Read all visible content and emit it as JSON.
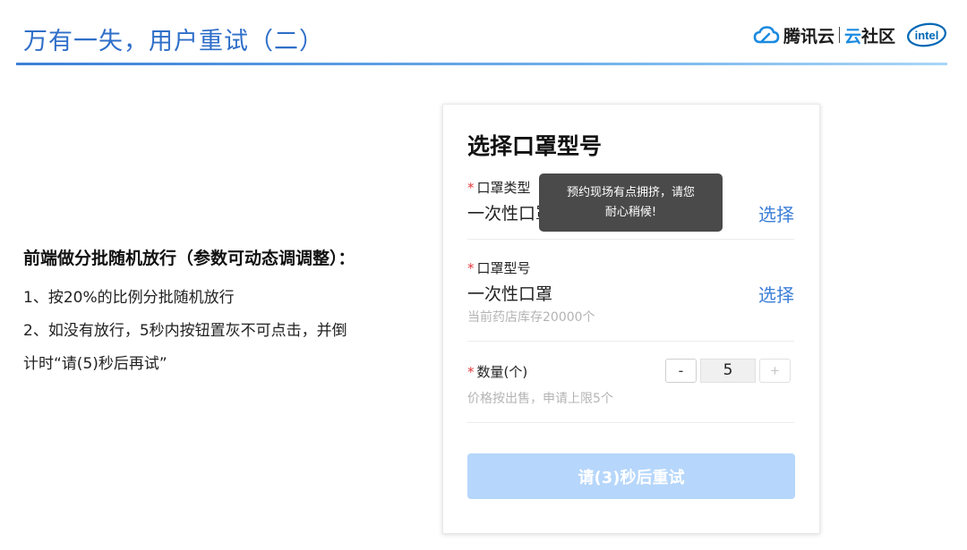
{
  "slide": {
    "title": "万有一失，用户重试（二）",
    "logos": {
      "brand": "腾讯云",
      "brand_yun": "云",
      "brand_community": "社区",
      "intel_text": "intel",
      "brand_color": "#1a8ae0",
      "intel_color": "#0068b5"
    }
  },
  "description": {
    "heading": "前端做分批随机放行（参数可动态调调整）：",
    "items": [
      "1、按20%的比例分批随机放行",
      "2、如没有放行，5秒内按钮置灰不可点击，并倒",
      "计时“请(5)秒后再试”"
    ]
  },
  "card": {
    "title": "选择口罩型号",
    "required_mark": "*",
    "mask_type": {
      "label": "口罩类型",
      "value": "一次性口罩",
      "action": "选择"
    },
    "mask_model": {
      "label": "口罩型号",
      "value": "一次性口罩",
      "action": "选择",
      "hint": "当前药店库存20000个"
    },
    "quantity": {
      "label": "数量(个)",
      "hint": "价格按出售，申请上限5个",
      "minus": "-",
      "value": "5",
      "plus": "+"
    },
    "submit_label": "请(3)秒后重试",
    "toast": {
      "line1": "预约现场有点拥挤，请您",
      "line2": "耐心稍候!"
    },
    "accent_color": "#3d7fd8",
    "disabled_button_color": "#b6d6fb"
  }
}
